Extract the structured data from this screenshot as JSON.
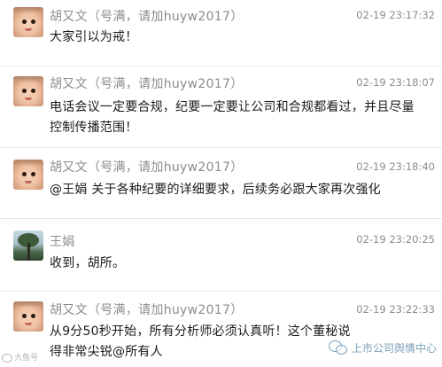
{
  "messages": [
    {
      "sender": "胡又文（号满，请加huyw2017）",
      "time": "02-19 23:17:32",
      "avatar": "baby-photo-avatar",
      "text": "大家引以为戒！"
    },
    {
      "sender": "胡又文（号满，请加huyw2017）",
      "time": "02-19 23:18:07",
      "avatar": "baby-photo-avatar",
      "text": "电话会议一定要合规，纪要一定要让公司和合规都看过，并且尽量控制传播范围！"
    },
    {
      "sender": "胡又文（号满，请加huyw2017）",
      "time": "02-19 23:18:40",
      "avatar": "baby-photo-avatar",
      "text": "@王娟 关于各种纪要的详细要求，后续务必跟大家再次强化"
    },
    {
      "sender": "王娟",
      "time": "02-19 23:20:25",
      "avatar": "tree-photo-avatar",
      "text": "收到，胡所。"
    },
    {
      "sender": "胡又文（号满，请加huyw2017）",
      "time": "02-19 23:22:33",
      "avatar": "baby-photo-avatar",
      "text": "从9分50秒开始，所有分析师必须认真听！这个董秘说得非常尖锐@所有人"
    }
  ],
  "watermarks": {
    "left": "大鱼号",
    "right": "上市公司舆情中心",
    "right_icon": "wechat-icon"
  }
}
